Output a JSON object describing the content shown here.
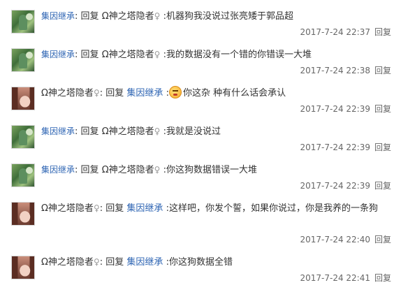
{
  "replies": [
    {
      "author": "集因继承",
      "reply_word": "回复",
      "target": "Ω神之塔隐者",
      "gender": "♀",
      "sep": ":",
      "message": "机器狗我没说过张亮矮于郭品超",
      "time": "2017-7-24 22:37",
      "reply_link": "回复"
    },
    {
      "author": "集因继承",
      "reply_word": "回复",
      "target": "Ω神之塔隐者",
      "gender": "♀",
      "sep": ":",
      "message": "我的数据没有一个错的你错误一大堆",
      "time": "2017-7-24 22:38",
      "reply_link": "回复"
    },
    {
      "author": "Ω神之塔隐者",
      "gender": "♀",
      "reply_word": "回复",
      "target": "集因继承",
      "sep": ":",
      "message": "你这杂 种有什么话会承认",
      "time": "2017-7-24 22:39",
      "reply_link": "回复"
    },
    {
      "author": "集因继承",
      "reply_word": "回复",
      "target": "Ω神之塔隐者",
      "gender": "♀",
      "sep": ":",
      "message": "我就是没说过",
      "time": "2017-7-24 22:39",
      "reply_link": "回复"
    },
    {
      "author": "集因继承",
      "reply_word": "回复",
      "target": "Ω神之塔隐者",
      "gender": "♀",
      "sep": ":",
      "message": "你这狗数据错误一大堆",
      "time": "2017-7-24 22:39",
      "reply_link": "回复"
    },
    {
      "author": "Ω神之塔隐者",
      "gender": "♀",
      "reply_word": "回复",
      "target": "集因继承",
      "sep": ":",
      "message": "这样吧，你发个誓，如果你说过，你是我养的一条狗",
      "time": "2017-7-24 22:40",
      "reply_link": "回复"
    },
    {
      "author": "Ω神之塔隐者",
      "gender": "♀",
      "reply_word": "回复",
      "target": "集因继承",
      "sep": ":",
      "message": "你这狗数据全错",
      "time": "2017-7-24 22:41",
      "reply_link": "回复"
    }
  ],
  "icons": {
    "avatar_a": "landscape-avatar",
    "avatar_b": "portrait-avatar",
    "emoji": "angry-face-emoji"
  },
  "colors": {
    "link": "#2d64b3",
    "text": "#333333",
    "meta": "#666666"
  }
}
